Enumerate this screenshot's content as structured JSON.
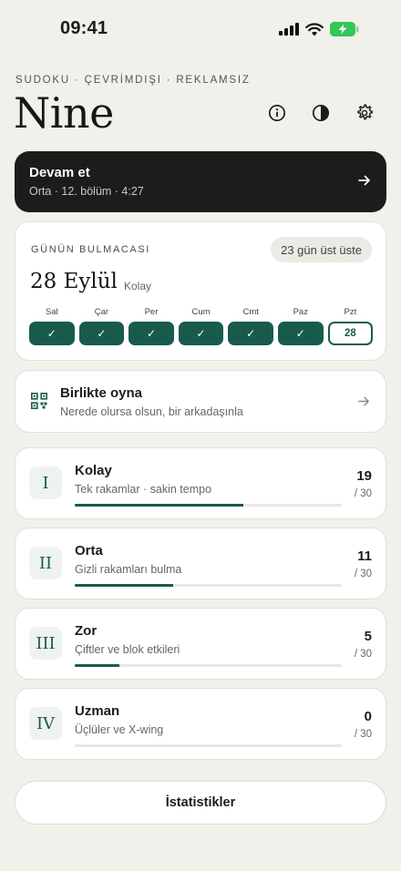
{
  "status": {
    "time": "09:41"
  },
  "header": {
    "kicker": "SUDOKU · ÇEVRİMDIŞI · REKLAMSIZ",
    "title": "Nine",
    "icons": [
      "info-icon",
      "contrast-icon",
      "gear-icon"
    ]
  },
  "continue_card": {
    "title": "Devam et",
    "subtitle": "Orta · 12. bölüm · 4:27"
  },
  "daily": {
    "label": "GÜNÜN BULMACASI",
    "streak": "23 gün üst üste",
    "date": "28 Eylül",
    "difficulty": "Kolay",
    "week": [
      {
        "day": "Sal",
        "mark": "✓",
        "done": true
      },
      {
        "day": "Çar",
        "mark": "✓",
        "done": true
      },
      {
        "day": "Per",
        "mark": "✓",
        "done": true
      },
      {
        "day": "Cum",
        "mark": "✓",
        "done": true
      },
      {
        "day": "Cmt",
        "mark": "✓",
        "done": true
      },
      {
        "day": "Paz",
        "mark": "✓",
        "done": true
      },
      {
        "day": "Pzt",
        "mark": "28",
        "done": false
      }
    ]
  },
  "together": {
    "title": "Birlikte oyna",
    "subtitle": "Nerede olursa olsun, bir arkadaşınla"
  },
  "levels": [
    {
      "numeral": "I",
      "name": "Kolay",
      "desc": "Tek rakamlar · sakin tempo",
      "count": "19",
      "total": "/ 30",
      "progress": 0.633
    },
    {
      "numeral": "II",
      "name": "Orta",
      "desc": "Gizli rakamları bulma",
      "count": "11",
      "total": "/ 30",
      "progress": 0.367
    },
    {
      "numeral": "III",
      "name": "Zor",
      "desc": "Çiftler ve blok etkileri",
      "count": "5",
      "total": "/ 30",
      "progress": 0.167
    },
    {
      "numeral": "IV",
      "name": "Uzman",
      "desc": "Üçlüler ve X-wing",
      "count": "0",
      "total": "/ 30",
      "progress": 0
    }
  ],
  "stats_button": "İstatistikler",
  "colors": {
    "accent": "#185b4c",
    "background": "#f1f0eb",
    "dark_card": "#1b1c1c"
  }
}
